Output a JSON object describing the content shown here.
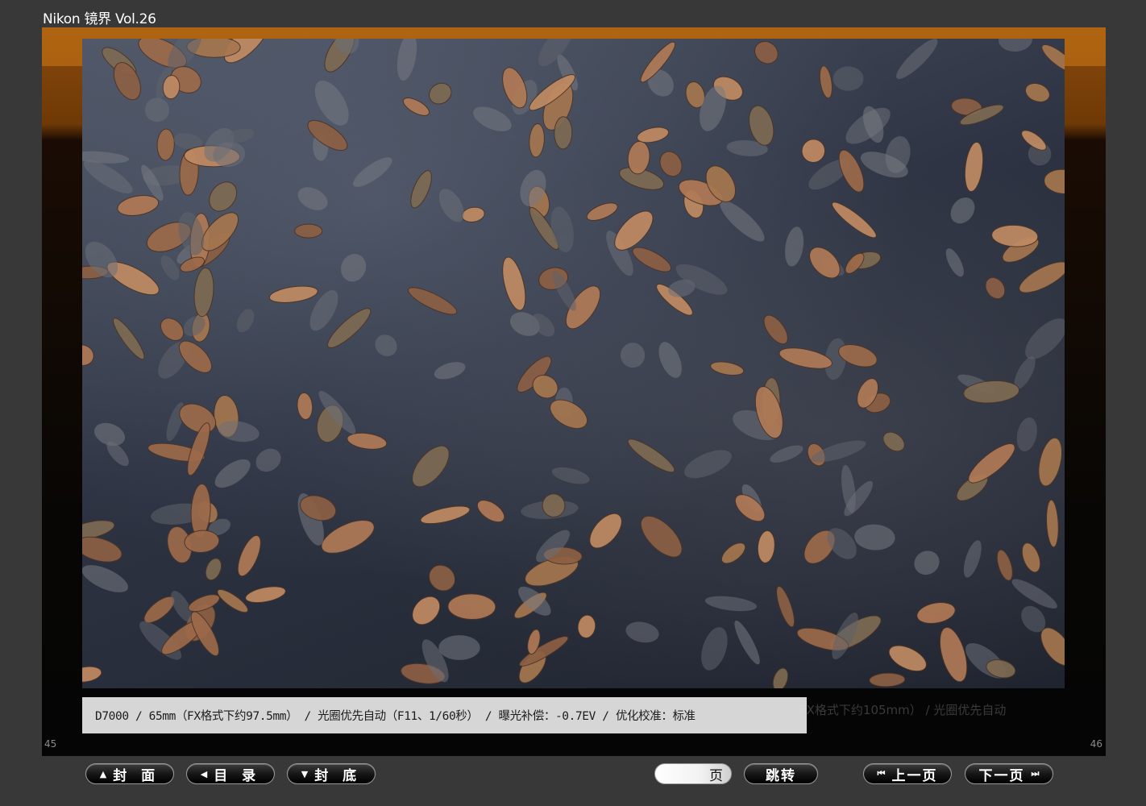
{
  "app": {
    "title": "Nikon 镜界 Vol.26"
  },
  "viewer": {
    "page_left": "45",
    "page_right": "46",
    "ghost_caption": "FX格式下约105mm） / 光圈优先自动",
    "photo_caption": "D7000 / 65mm（FX格式下约97.5mm） / 光圈优先自动（F11、1/60秒） / 曝光补偿：-0.7EV / 优化校准：标准"
  },
  "toolbar": {
    "cover_label": "封 面",
    "toc_label": "目 录",
    "back_cover_label": "封 底",
    "page_input_value": "",
    "page_suffix": "页",
    "jump_label": "跳转",
    "prev_label": "上一页",
    "next_label": "下一页"
  },
  "icons": {
    "cover": "triangle-up-icon",
    "toc": "triangle-left-icon",
    "back_cover": "triangle-down-icon",
    "prev": "skip-back-icon",
    "next": "skip-forward-icon"
  }
}
